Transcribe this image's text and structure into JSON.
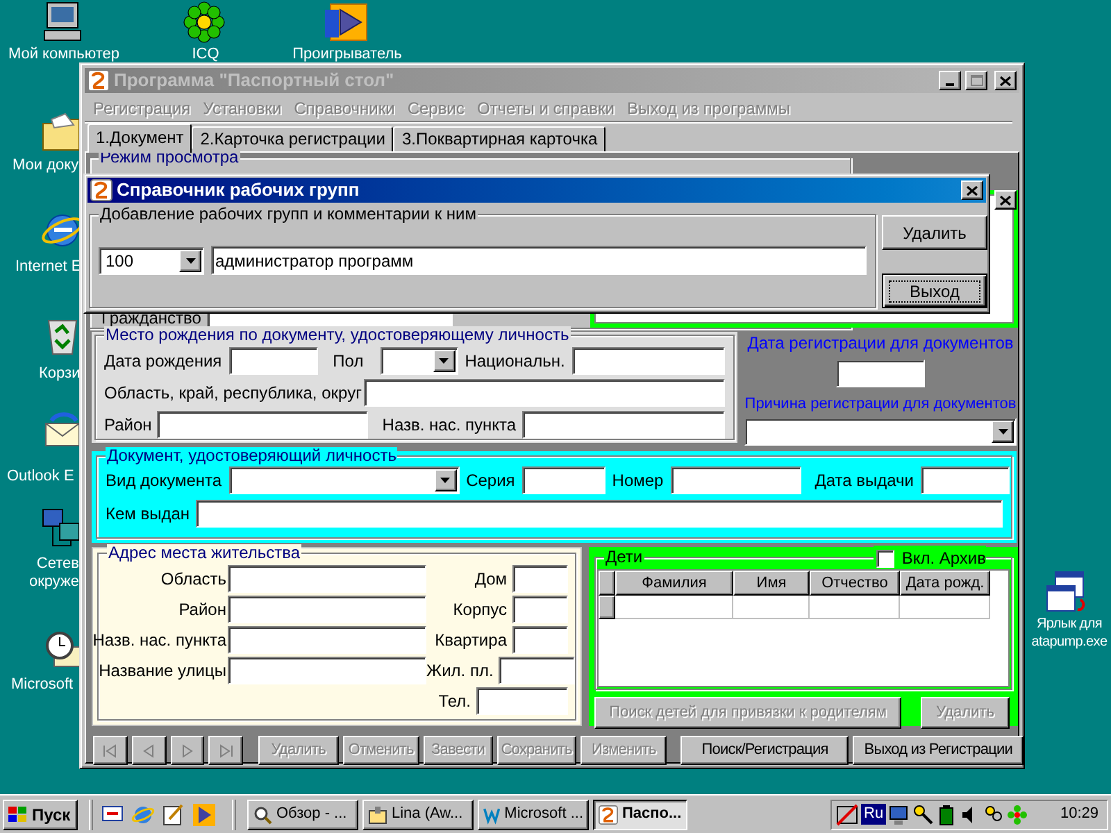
{
  "desktop_icons": [
    {
      "label": "Мой компьютер"
    },
    {
      "label": "ICQ"
    },
    {
      "label": "Проигрыватель"
    },
    {
      "label": "Мои доку"
    },
    {
      "label": "Internet E"
    },
    {
      "label": "Корзи"
    },
    {
      "label": "Outlook E"
    },
    {
      "label": "Сетев окруже"
    },
    {
      "label": "Microsoft"
    },
    {
      "label": "Ярлык для atapump.exe"
    }
  ],
  "main_window": {
    "title": "Программа \"Паспортный стол\"",
    "menu": [
      {
        "label": "Регистрация",
        "disabled": true
      },
      {
        "label": "Установки",
        "disabled": true
      },
      {
        "label": "Справочники",
        "disabled": true
      },
      {
        "label": "Сервис",
        "disabled": true
      },
      {
        "label": "Отчеты и справки",
        "disabled": true
      },
      {
        "label": "Выход из программы",
        "disabled": true
      }
    ],
    "tabs": [
      {
        "label": "1.Документ",
        "selected": true
      },
      {
        "label": "2.Карточка регистрации",
        "selected": false
      },
      {
        "label": "3.Поквартирная карточка",
        "selected": false
      }
    ],
    "view_mode": {
      "title": "Режим просмотра",
      "citizenship_label": "Гражданство"
    },
    "birth_place": {
      "title": "Место рождения по документу, удостоверяющему личность",
      "birth_date_label": "Дата рождения",
      "sex_label": "Пол",
      "nationality_label": "Национальн.",
      "region_label": "Область, край, республика, округ",
      "district_label": "Район",
      "locality_label": "Назв. нас. пункта"
    },
    "registration": {
      "date_label": "Дата регистрации для документов",
      "reason_label": "Причина регистрации для документов"
    },
    "identity_document": {
      "title": "Документ, удостоверяющий личность",
      "type_label": "Вид документа",
      "series_label": "Серия",
      "number_label": "Номер",
      "issue_date_label": "Дата выдачи",
      "issued_by_label": "Кем выдан"
    },
    "address": {
      "title": "Адрес места жительства",
      "left_fields": [
        "Область",
        "Район",
        "Назв. нас. пункта",
        "Название улицы"
      ],
      "right_fields": [
        "Дом",
        "Корпус",
        "Квартира",
        "Жил. пл.",
        "Тел."
      ]
    },
    "children": {
      "title": "Дети",
      "archive": {
        "label": "Вкл. Архив",
        "checked": false
      },
      "columns": [
        "Фамилия",
        "Имя",
        "Отчество",
        "Дата рожд."
      ],
      "buttons": [
        {
          "label": "Поиск детей для привязки к родителям",
          "disabled": true
        },
        {
          "label": "Удалить",
          "disabled": true
        }
      ]
    },
    "toolbar": {
      "nav_buttons": [
        {
          "disabled": true
        },
        {
          "disabled": true
        },
        {
          "disabled": true
        },
        {
          "disabled": true
        }
      ],
      "buttons": [
        {
          "label": "Удалить",
          "disabled": true
        },
        {
          "label": "Отменить",
          "disabled": true
        },
        {
          "label": "Завести",
          "disabled": true
        },
        {
          "label": "Сохранить",
          "disabled": true
        },
        {
          "label": "Изменить",
          "disabled": true
        },
        {
          "label": "Поиск/Регистрация",
          "disabled": false
        },
        {
          "label": "Выход из Регистрации",
          "disabled": false
        }
      ]
    }
  },
  "dialog": {
    "title": "Справочник рабочих групп",
    "group_title": "Добавление рабочих групп и комментарии к ним",
    "code": "100",
    "comment": "администратор программ",
    "buttons": [
      {
        "label": "Удалить",
        "focused": false
      },
      {
        "label": "Выход",
        "focused": true
      }
    ]
  },
  "taskbar": {
    "start": "Пуск",
    "tasks": [
      {
        "label": "Обзор - ...",
        "selected": false
      },
      {
        "label": "Lina (Aw...",
        "selected": false
      },
      {
        "label": "Microsoft ...",
        "selected": false
      },
      {
        "label": "Паспо...",
        "selected": true
      }
    ],
    "language": "Ru",
    "clock": "10:29"
  }
}
